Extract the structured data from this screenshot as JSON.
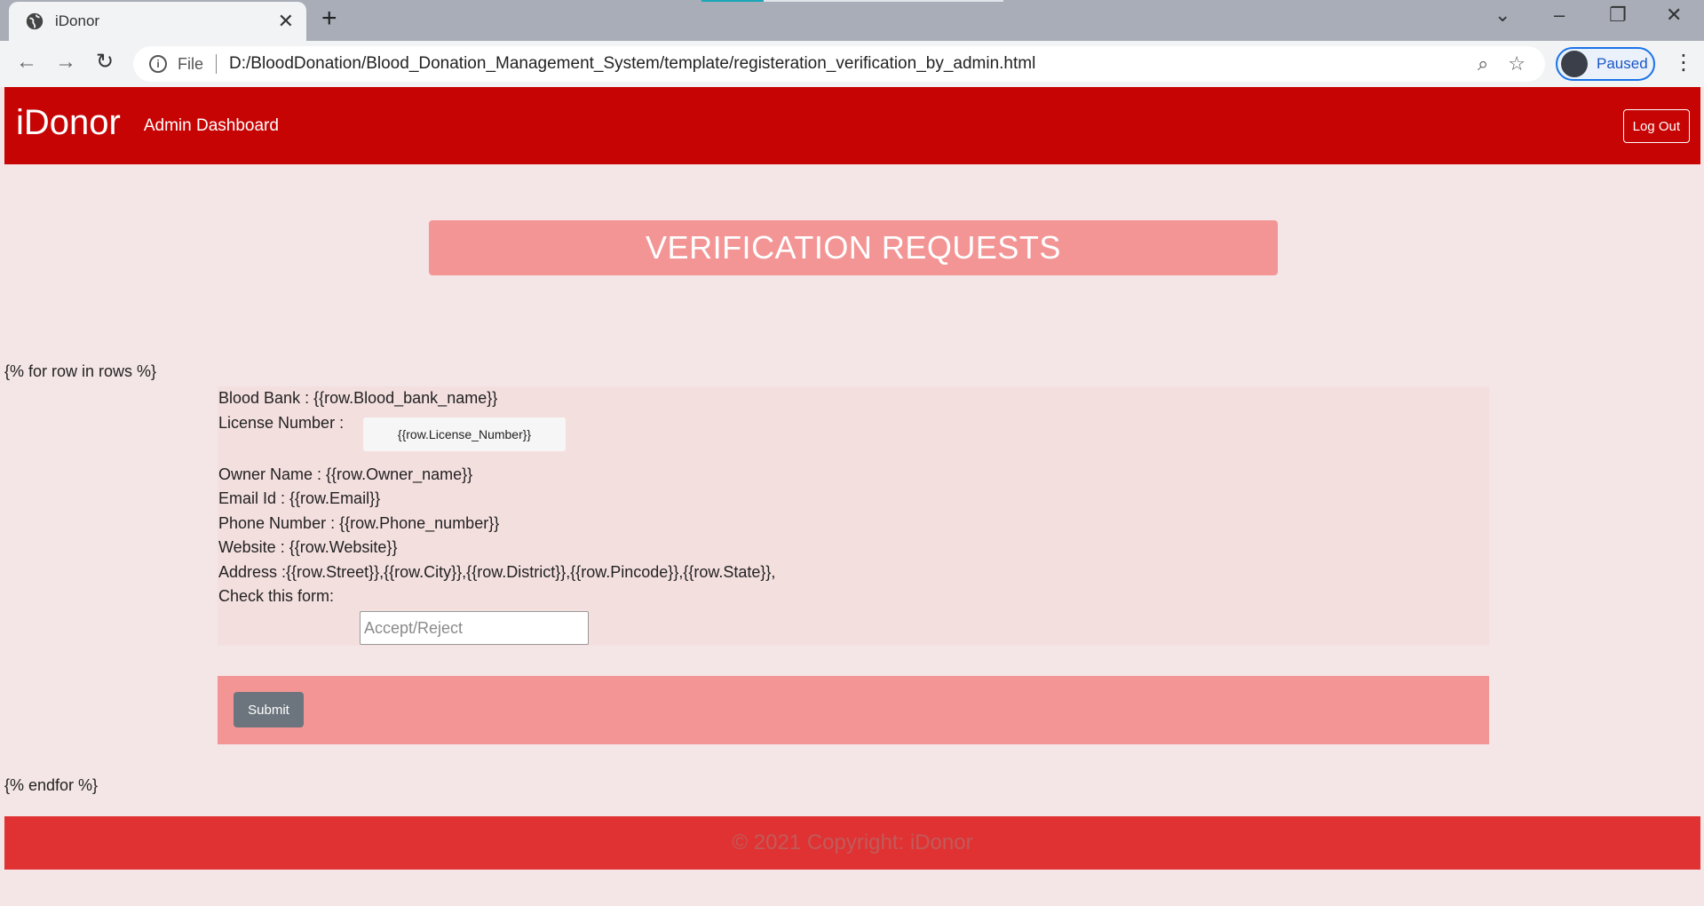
{
  "browser": {
    "tab_title": "iDonor",
    "tab_close": "✕",
    "new_tab": "+",
    "file_label": "File",
    "url": "D:/BloodDonation/Blood_Donation_Management_System/template/registeration_verification_by_admin.html",
    "profile_status": "Paused",
    "icons": {
      "globe": "globe-icon",
      "back": "←",
      "forward": "→",
      "reload": "↻",
      "zoom": "⌕",
      "star": "☆",
      "menu": "⋮",
      "tab_search": "⌄",
      "minimize": "–",
      "restore": "❐",
      "close": "✕",
      "info": "i"
    }
  },
  "navbar": {
    "brand": "iDonor",
    "link": "Admin Dashboard",
    "logout_label": "Log Out",
    "color": "#c70404"
  },
  "main": {
    "heading": "VERIFICATION REQUESTS",
    "loop_start": "{% for row in rows %}",
    "loop_end": "{% endfor %}",
    "fields": {
      "blood_bank": "Blood Bank : {{row.Blood_bank_name}}",
      "license_label": "License Number :",
      "license_value": "{{row.License_Number}}",
      "owner": "Owner Name : {{row.Owner_name}}",
      "email": "Email Id : {{row.Email}}",
      "phone": "Phone Number : {{row.Phone_number}}",
      "website": "Website : {{row.Website}}",
      "address": "Address :{{row.Street}},{{row.City}},{{row.District}},{{row.Pincode}},{{row.State}},",
      "check_label": "Check this form:",
      "check_placeholder": "Accept/Reject"
    },
    "submit_label": "Submit",
    "accent_color": "#f49595"
  },
  "footer": {
    "text": "© 2021 Copyright: iDonor",
    "color": "#e03232"
  }
}
